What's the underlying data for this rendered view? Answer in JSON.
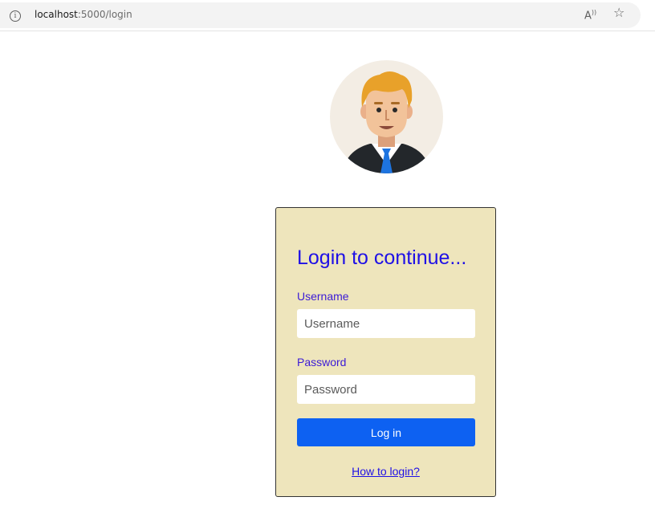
{
  "browser": {
    "url_host": "localhost",
    "url_path": ":5000/login",
    "info_icon": "ⓘ",
    "read_aloud_label": "A",
    "read_aloud_sup": "))",
    "favorite_icon": "☆"
  },
  "avatar": {
    "icon": "user-avatar-icon"
  },
  "login": {
    "title": "Login to continue...",
    "username_label": "Username",
    "username_placeholder": "Username",
    "username_value": "",
    "password_label": "Password",
    "password_placeholder": "Password",
    "password_value": "",
    "submit_label": "Log in",
    "help_link": "How to login?"
  },
  "colors": {
    "card_background": "#eee5bc",
    "title_color": "#1f10e6",
    "button_background": "#0d61f2"
  }
}
